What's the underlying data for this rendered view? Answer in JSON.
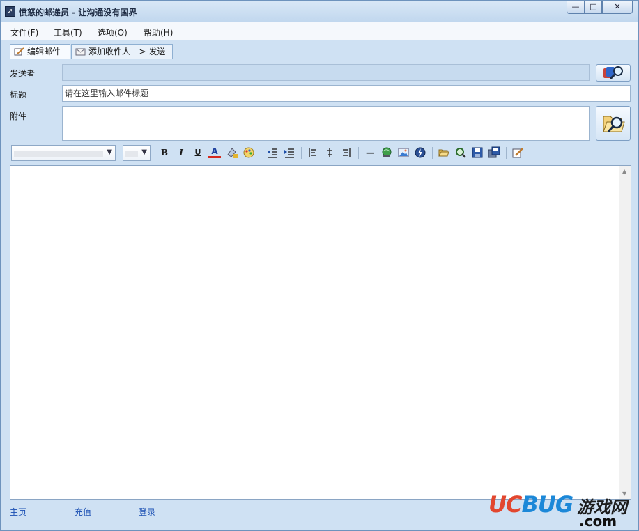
{
  "window": {
    "title": "愤怒的邮递员 - 让沟通没有国界",
    "app_icon": "paper-plane-icon",
    "controls": {
      "minimize": "—",
      "maximize": "□",
      "close": "✕"
    }
  },
  "menu": [
    {
      "label": "文件(F)"
    },
    {
      "label": "工具(T)"
    },
    {
      "label": "选项(O)"
    },
    {
      "label": "帮助(H)"
    }
  ],
  "tabs": [
    {
      "label": "编辑邮件",
      "icon": "edit-mail-icon",
      "active": true
    },
    {
      "label": "添加收件人 --> 发送",
      "icon": "envelope-icon",
      "active": false
    }
  ],
  "form": {
    "sender_label": "发送者",
    "sender_value": "",
    "subject_label": "标题",
    "subject_value": "请在这里输入邮件标题",
    "attachment_label": "附件",
    "attachment_value": ""
  },
  "toolbar": {
    "font_name": "",
    "font_size": "",
    "buttons": [
      "bold-icon",
      "italic-icon",
      "underline-icon",
      "font-color-icon",
      "highlight-color-icon",
      "palette-icon",
      "decrease-indent-icon",
      "increase-indent-icon",
      "align-left-icon",
      "align-center-icon",
      "align-right-icon",
      "horizontal-rule-icon",
      "insert-link-icon",
      "insert-image-icon",
      "insert-flash-icon",
      "open-file-icon",
      "preview-icon",
      "save-icon",
      "save-as-icon",
      "edit-source-icon"
    ],
    "glyphs": {
      "bold": "B",
      "italic": "I",
      "underline": "U",
      "font_color": "A",
      "hr": "—"
    }
  },
  "editor": {
    "content": ""
  },
  "footer": {
    "links": [
      {
        "label": "主页"
      },
      {
        "label": "充值"
      },
      {
        "label": "登录"
      }
    ]
  },
  "watermark": {
    "brand_u": "UC",
    "brand_b": "BUG",
    "cn": "游戏网",
    "domain": ".com"
  },
  "colors": {
    "window_bg": "#cfe1f3",
    "title_bg": "#c1d7ee",
    "link": "#1a4fb3",
    "watermark_red": "#e2472f",
    "watermark_blue": "#1c88d8"
  }
}
